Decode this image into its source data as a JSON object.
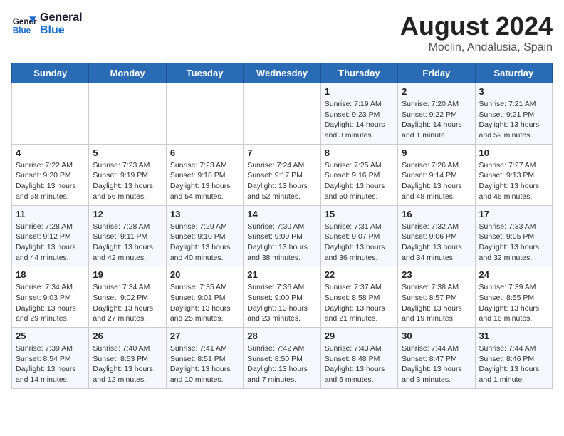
{
  "logo": {
    "line1": "General",
    "line2": "Blue"
  },
  "title": "August 2024",
  "subtitle": "Moclin, Andalusia, Spain",
  "days_of_week": [
    "Sunday",
    "Monday",
    "Tuesday",
    "Wednesday",
    "Thursday",
    "Friday",
    "Saturday"
  ],
  "weeks": [
    [
      {
        "day": "",
        "info": ""
      },
      {
        "day": "",
        "info": ""
      },
      {
        "day": "",
        "info": ""
      },
      {
        "day": "",
        "info": ""
      },
      {
        "day": "1",
        "info": "Sunrise: 7:19 AM\nSunset: 9:23 PM\nDaylight: 14 hours\nand 3 minutes."
      },
      {
        "day": "2",
        "info": "Sunrise: 7:20 AM\nSunset: 9:22 PM\nDaylight: 14 hours\nand 1 minute."
      },
      {
        "day": "3",
        "info": "Sunrise: 7:21 AM\nSunset: 9:21 PM\nDaylight: 13 hours\nand 59 minutes."
      }
    ],
    [
      {
        "day": "4",
        "info": "Sunrise: 7:22 AM\nSunset: 9:20 PM\nDaylight: 13 hours\nand 58 minutes."
      },
      {
        "day": "5",
        "info": "Sunrise: 7:23 AM\nSunset: 9:19 PM\nDaylight: 13 hours\nand 56 minutes."
      },
      {
        "day": "6",
        "info": "Sunrise: 7:23 AM\nSunset: 9:18 PM\nDaylight: 13 hours\nand 54 minutes."
      },
      {
        "day": "7",
        "info": "Sunrise: 7:24 AM\nSunset: 9:17 PM\nDaylight: 13 hours\nand 52 minutes."
      },
      {
        "day": "8",
        "info": "Sunrise: 7:25 AM\nSunset: 9:16 PM\nDaylight: 13 hours\nand 50 minutes."
      },
      {
        "day": "9",
        "info": "Sunrise: 7:26 AM\nSunset: 9:14 PM\nDaylight: 13 hours\nand 48 minutes."
      },
      {
        "day": "10",
        "info": "Sunrise: 7:27 AM\nSunset: 9:13 PM\nDaylight: 13 hours\nand 46 minutes."
      }
    ],
    [
      {
        "day": "11",
        "info": "Sunrise: 7:28 AM\nSunset: 9:12 PM\nDaylight: 13 hours\nand 44 minutes."
      },
      {
        "day": "12",
        "info": "Sunrise: 7:28 AM\nSunset: 9:11 PM\nDaylight: 13 hours\nand 42 minutes."
      },
      {
        "day": "13",
        "info": "Sunrise: 7:29 AM\nSunset: 9:10 PM\nDaylight: 13 hours\nand 40 minutes."
      },
      {
        "day": "14",
        "info": "Sunrise: 7:30 AM\nSunset: 9:09 PM\nDaylight: 13 hours\nand 38 minutes."
      },
      {
        "day": "15",
        "info": "Sunrise: 7:31 AM\nSunset: 9:07 PM\nDaylight: 13 hours\nand 36 minutes."
      },
      {
        "day": "16",
        "info": "Sunrise: 7:32 AM\nSunset: 9:06 PM\nDaylight: 13 hours\nand 34 minutes."
      },
      {
        "day": "17",
        "info": "Sunrise: 7:33 AM\nSunset: 9:05 PM\nDaylight: 13 hours\nand 32 minutes."
      }
    ],
    [
      {
        "day": "18",
        "info": "Sunrise: 7:34 AM\nSunset: 9:03 PM\nDaylight: 13 hours\nand 29 minutes."
      },
      {
        "day": "19",
        "info": "Sunrise: 7:34 AM\nSunset: 9:02 PM\nDaylight: 13 hours\nand 27 minutes."
      },
      {
        "day": "20",
        "info": "Sunrise: 7:35 AM\nSunset: 9:01 PM\nDaylight: 13 hours\nand 25 minutes."
      },
      {
        "day": "21",
        "info": "Sunrise: 7:36 AM\nSunset: 9:00 PM\nDaylight: 13 hours\nand 23 minutes."
      },
      {
        "day": "22",
        "info": "Sunrise: 7:37 AM\nSunset: 8:58 PM\nDaylight: 13 hours\nand 21 minutes."
      },
      {
        "day": "23",
        "info": "Sunrise: 7:38 AM\nSunset: 8:57 PM\nDaylight: 13 hours\nand 19 minutes."
      },
      {
        "day": "24",
        "info": "Sunrise: 7:39 AM\nSunset: 8:55 PM\nDaylight: 13 hours\nand 16 minutes."
      }
    ],
    [
      {
        "day": "25",
        "info": "Sunrise: 7:39 AM\nSunset: 8:54 PM\nDaylight: 13 hours\nand 14 minutes."
      },
      {
        "day": "26",
        "info": "Sunrise: 7:40 AM\nSunset: 8:53 PM\nDaylight: 13 hours\nand 12 minutes."
      },
      {
        "day": "27",
        "info": "Sunrise: 7:41 AM\nSunset: 8:51 PM\nDaylight: 13 hours\nand 10 minutes."
      },
      {
        "day": "28",
        "info": "Sunrise: 7:42 AM\nSunset: 8:50 PM\nDaylight: 13 hours\nand 7 minutes."
      },
      {
        "day": "29",
        "info": "Sunrise: 7:43 AM\nSunset: 8:48 PM\nDaylight: 13 hours\nand 5 minutes."
      },
      {
        "day": "30",
        "info": "Sunrise: 7:44 AM\nSunset: 8:47 PM\nDaylight: 13 hours\nand 3 minutes."
      },
      {
        "day": "31",
        "info": "Sunrise: 7:44 AM\nSunset: 8:46 PM\nDaylight: 13 hours\nand 1 minute."
      }
    ]
  ]
}
